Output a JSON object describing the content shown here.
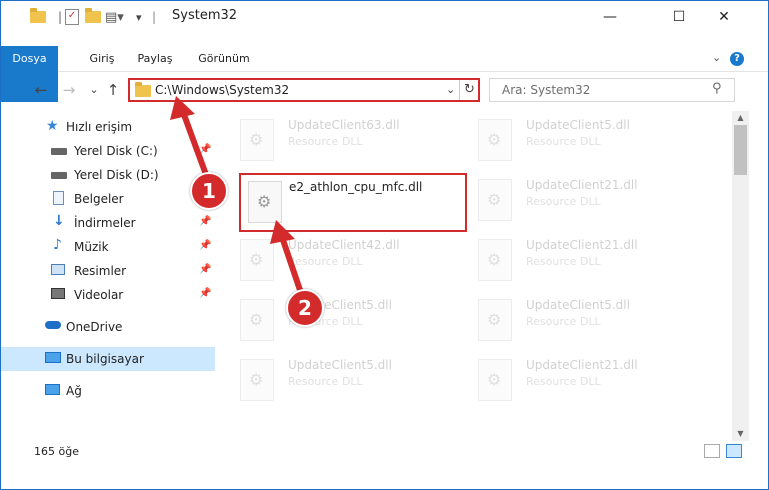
{
  "window": {
    "title": "System32",
    "minimize": "—",
    "maximize": "☐",
    "close": "✕"
  },
  "ribbon": {
    "tabs": [
      "Dosya",
      "Giriş",
      "Paylaş",
      "Görünüm"
    ],
    "help": "?",
    "expand": "⌄"
  },
  "nav": {
    "back": "←",
    "forward": "→",
    "recent": "⌄",
    "up": "↑",
    "address": "C:\\Windows\\System32",
    "address_dropdown": "⌄",
    "refresh": "↻",
    "search_placeholder": "Ara: System32",
    "search_icon": "search-icon"
  },
  "sidebar": {
    "items": [
      {
        "label": "Hızlı erişim",
        "icon": "star-icon"
      },
      {
        "label": "Yerel Disk (C:)",
        "icon": "drive-icon"
      },
      {
        "label": "Yerel Disk (D:)",
        "icon": "drive-icon"
      },
      {
        "label": "Belgeler",
        "icon": "documents-icon"
      },
      {
        "label": "İndirmeler",
        "icon": "download-icon"
      },
      {
        "label": "Müzik",
        "icon": "music-icon"
      },
      {
        "label": "Resimler",
        "icon": "pictures-icon"
      },
      {
        "label": "Videolar",
        "icon": "videos-icon"
      },
      {
        "label": "OneDrive",
        "icon": "cloud-icon"
      },
      {
        "label": "Bu bilgisayar",
        "icon": "computer-icon"
      },
      {
        "label": "Ağ",
        "icon": "network-icon"
      }
    ]
  },
  "files": {
    "highlighted": {
      "name": "e2_athlon_cpu_mfc.dll"
    },
    "left_column": [
      {
        "name": "UpdateClient63.dll",
        "type": "Resource DLL"
      },
      {
        "name": "UpdateClient42.dll",
        "type": "Resource DLL"
      },
      {
        "name": "UpdateClient5.dll",
        "type": "Resource DLL"
      },
      {
        "name": "UpdateClient5.dll",
        "type": "Resource DLL"
      }
    ],
    "right_column": [
      {
        "name": "UpdateClient5.dll",
        "type": "Resource DLL"
      },
      {
        "name": "UpdateClient21.dll",
        "type": "Resource DLL"
      },
      {
        "name": "UpdateClient21.dll",
        "type": "Resource DLL"
      },
      {
        "name": "UpdateClient5.dll",
        "type": "Resource DLL"
      },
      {
        "name": "UpdateClient21.dll",
        "type": "Resource DLL"
      }
    ]
  },
  "status": {
    "count": "165 öğe"
  },
  "annotations": {
    "step1": "1",
    "step2": "2",
    "color": "#d32b2b"
  }
}
